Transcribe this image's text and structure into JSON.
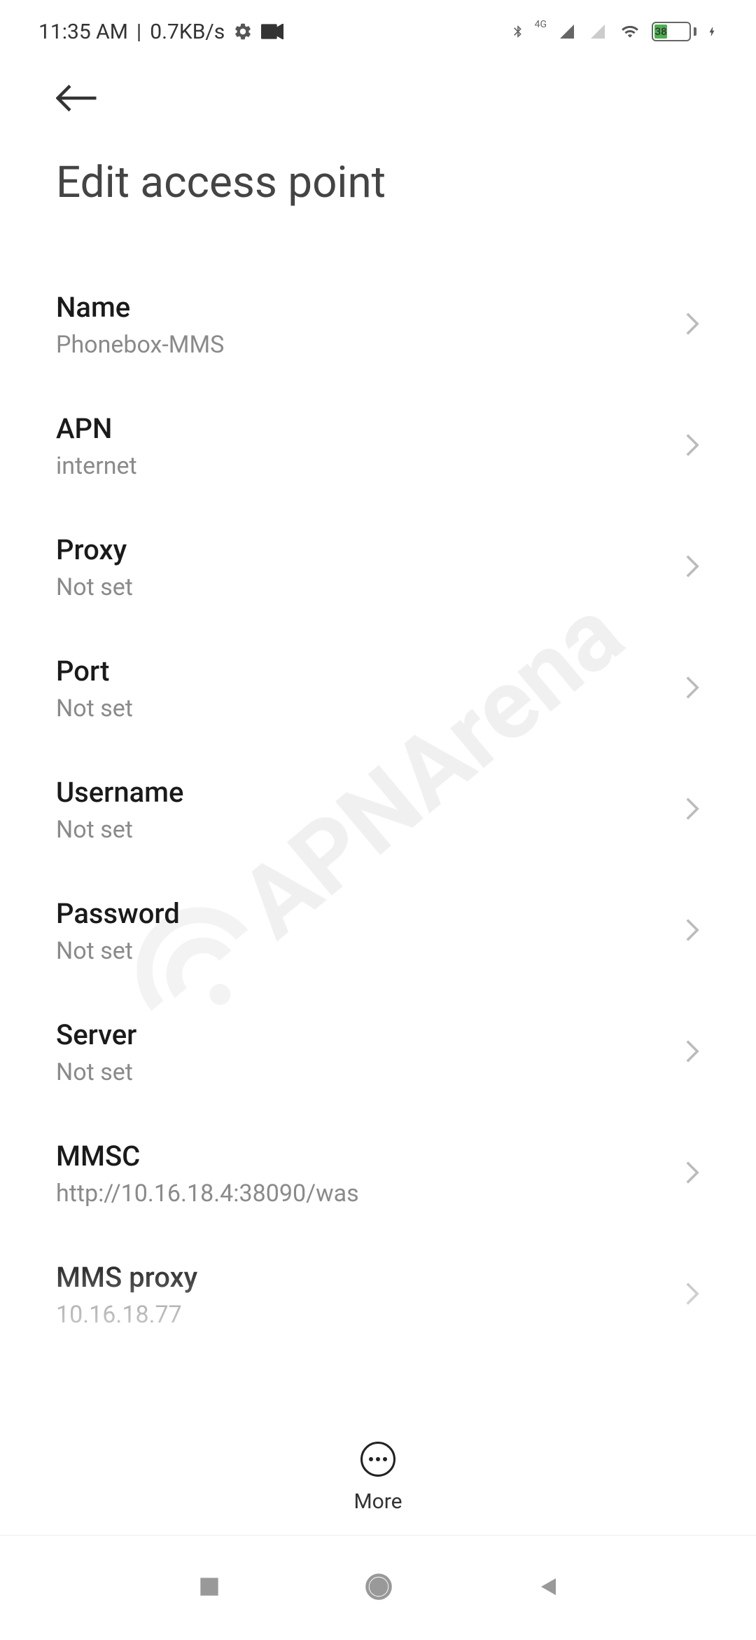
{
  "status_bar": {
    "time": "11:35 AM",
    "data_rate": "0.7KB/s",
    "signal_label": "4G",
    "battery_percent": "38"
  },
  "header": {
    "title": "Edit access point"
  },
  "settings": [
    {
      "label": "Name",
      "value": "Phonebox-MMS"
    },
    {
      "label": "APN",
      "value": "internet"
    },
    {
      "label": "Proxy",
      "value": "Not set"
    },
    {
      "label": "Port",
      "value": "Not set"
    },
    {
      "label": "Username",
      "value": "Not set"
    },
    {
      "label": "Password",
      "value": "Not set"
    },
    {
      "label": "Server",
      "value": "Not set"
    },
    {
      "label": "MMSC",
      "value": "http://10.16.18.4:38090/was"
    },
    {
      "label": "MMS proxy",
      "value": "10.16.18.77"
    }
  ],
  "actions": {
    "more_label": "More"
  },
  "watermark": {
    "text": "APNArena"
  }
}
